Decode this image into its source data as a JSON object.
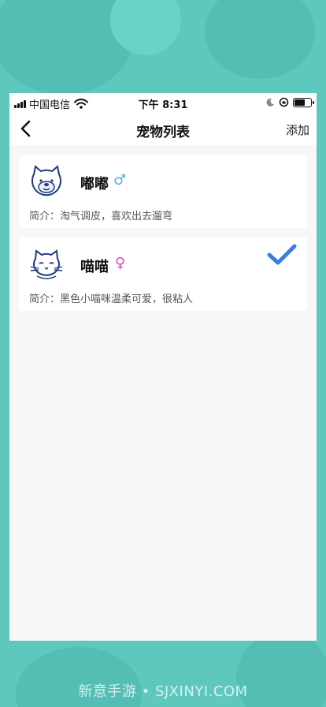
{
  "status_bar": {
    "carrier": "中国电信",
    "time": "下午 8:31"
  },
  "nav": {
    "title": "宠物列表",
    "add_label": "添加"
  },
  "pets": [
    {
      "name": "嘟嘟",
      "gender_symbol": "♂",
      "gender_color": "#5aaee0",
      "intro": "简介：淘气调皮，喜欢出去遛弯",
      "selected": false
    },
    {
      "name": "喵喵",
      "gender_symbol": "♀",
      "gender_color": "#d04fb8",
      "intro": "简介：黑色小喵咪温柔可爱，很粘人",
      "selected": true
    }
  ],
  "watermark": "新意手游 • SJXINYI.COM",
  "colors": {
    "background": "#5ec8bd",
    "accent_check": "#3b7be4",
    "avatar_stroke": "#223a7a"
  },
  "icons": [
    "signal-icon",
    "wifi-icon",
    "moon-icon",
    "rotation-lock-icon",
    "battery-icon",
    "back-arrow-icon",
    "dog-avatar-icon",
    "cat-avatar-icon",
    "checkmark-icon"
  ]
}
